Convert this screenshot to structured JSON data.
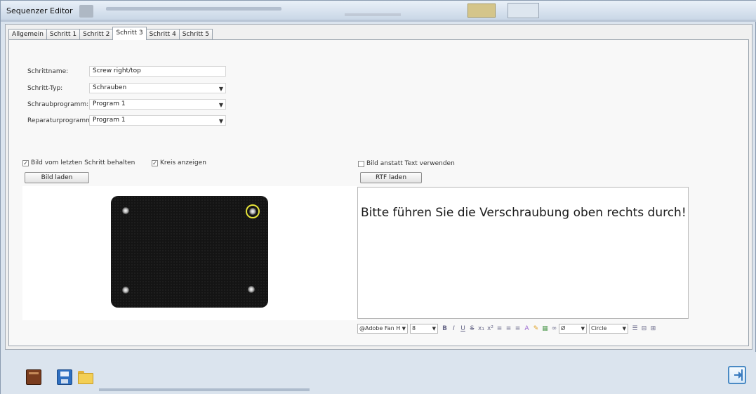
{
  "window": {
    "title": "Sequenzer Editor"
  },
  "tabs": [
    {
      "label": "Allgemein",
      "active": false
    },
    {
      "label": "Schritt 1",
      "active": false
    },
    {
      "label": "Schritt 2",
      "active": false
    },
    {
      "label": "Schritt 3",
      "active": true
    },
    {
      "label": "Schritt 4",
      "active": false
    },
    {
      "label": "Schritt 5",
      "active": false
    }
  ],
  "form": {
    "step_name": {
      "label": "Schrittname:",
      "value": "Screw right/top"
    },
    "step_type": {
      "label": "Schritt-Typ:",
      "value": "Schrauben"
    },
    "screw_program": {
      "label": "Schraubprogramm:",
      "value": "Program 1"
    },
    "repair_program": {
      "label": "Reparaturprogramm:",
      "value": "Program 1"
    }
  },
  "options": {
    "keep_image": {
      "label": "Bild vom letzten Schritt behalten",
      "checked": true
    },
    "show_circles": {
      "label": "Kreis anzeigen",
      "checked": true
    },
    "image_instead_text": {
      "label": "Bild anstatt Text verwenden",
      "checked": false
    }
  },
  "buttons": {
    "load_image": "Bild laden",
    "load_rtf": "RTF laden"
  },
  "rtf": {
    "text": "Bitte führen Sie die Verschraubung oben rechts durch!"
  },
  "format_toolbar": {
    "font": "@Adobe Fan H",
    "size": "8",
    "zoom": "Ø",
    "list_style": "Circle",
    "bold": "B",
    "italic": "I",
    "underline": "U",
    "strike": "S",
    "subscript": "x₁",
    "superscript": "x²"
  },
  "bottom_icons": [
    "book-icon",
    "save-icon",
    "folder-icon",
    "exit-icon"
  ],
  "colors": {
    "highlight_ring": "#e6e33a",
    "accent": "#4a8ac4"
  }
}
